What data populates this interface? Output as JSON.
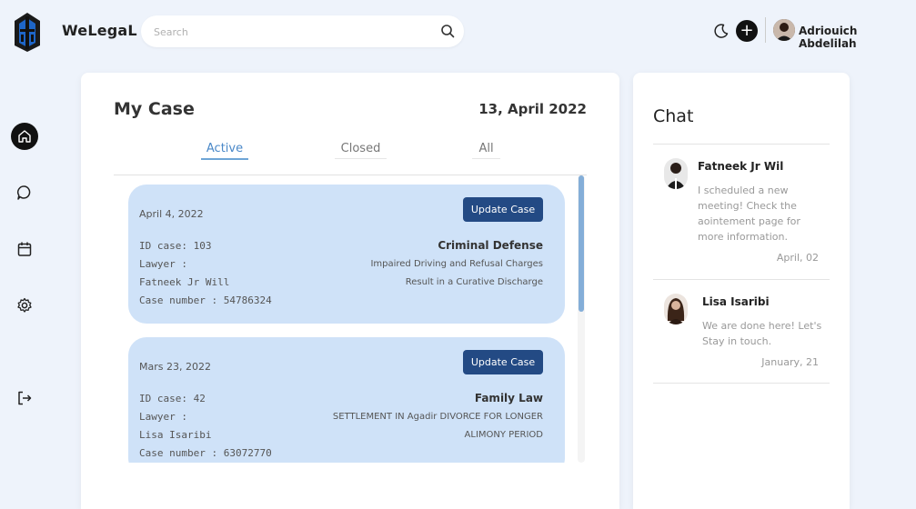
{
  "app": {
    "brand": "WeLegaL",
    "search_placeholder": "Search",
    "user_name": "Adriouich Abdelilah"
  },
  "sidebar": {
    "items": [
      {
        "icon": "home-icon",
        "active": true
      },
      {
        "icon": "chat-icon",
        "active": false
      },
      {
        "icon": "calendar-icon",
        "active": false
      },
      {
        "icon": "gear-icon",
        "active": false
      },
      {
        "icon": "logout-icon",
        "active": false
      }
    ]
  },
  "main": {
    "title": "My Case",
    "date": "13, April 2022",
    "tabs": [
      "Active",
      "Closed",
      "All"
    ],
    "active_tab": "Active",
    "cases": [
      {
        "date": "April 4, 2022",
        "button": "Update Case",
        "id_line": "ID case: 103",
        "lawyer_label": "Lawyer :",
        "lawyer_name": "Fatneek Jr Will",
        "case_number": "Case number : 54786324",
        "type": "Criminal Defense",
        "desc1": "Impaired Driving and Refusal Charges",
        "desc2": "Result in a Curative Discharge"
      },
      {
        "date": "Mars 23, 2022",
        "button": "Update Case",
        "id_line": "ID case: 42",
        "lawyer_label": "Lawyer :",
        "lawyer_name": "Lisa Isaribi",
        "case_number": "Case number : 63072770",
        "type": "Family Law",
        "desc1": "SETTLEMENT IN Agadir DIVORCE FOR LONGER",
        "desc2": "ALIMONY PERIOD"
      }
    ]
  },
  "chat": {
    "title": "Chat",
    "messages": [
      {
        "name": "Fatneek Jr Wil",
        "lines": [
          "I scheduled a new",
          "meeting! Check the",
          "aointement page for",
          "more information."
        ],
        "time": "April, 02"
      },
      {
        "name": "Lisa Isaribi",
        "lines": [
          "We are done here! Let's",
          "Stay in touch."
        ],
        "time": "January, 21"
      }
    ]
  },
  "colors": {
    "accent": "#234a84",
    "card_bg": "#cfe2f8",
    "tab_active": "#4a88c8"
  }
}
